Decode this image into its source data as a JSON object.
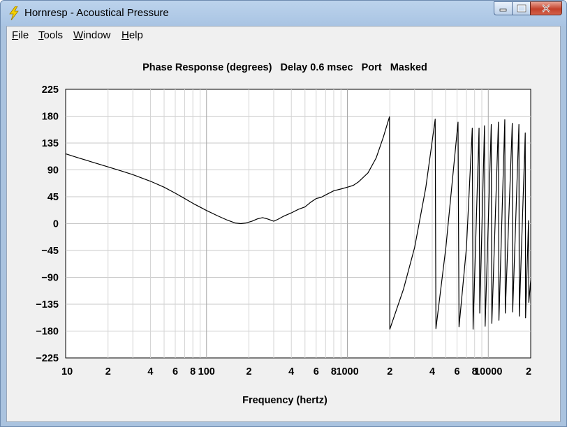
{
  "window": {
    "title": "Hornresp - Acoustical Pressure"
  },
  "menu": [
    {
      "label": "File",
      "mnemonic": "F",
      "rest": "ile"
    },
    {
      "label": "Tools",
      "mnemonic": "T",
      "rest": "ools"
    },
    {
      "label": "Window",
      "mnemonic": "W",
      "rest": "indow"
    },
    {
      "label": "Help",
      "mnemonic": "H",
      "rest": "elp"
    }
  ],
  "chart_data": {
    "type": "line",
    "title": "Phase Response (degrees)   Delay 0.6 msec   Port   Masked",
    "xlabel": "Frequency (hertz)",
    "ylabel": "",
    "x_scale": "log",
    "xlim": [
      10,
      20000
    ],
    "ylim": [
      -225,
      225
    ],
    "y_ticks": [
      225,
      180,
      135,
      90,
      45,
      0,
      -45,
      -90,
      -135,
      -180,
      -225
    ],
    "x_tick_labels": [
      {
        "value": 10,
        "label": "10"
      },
      {
        "value": 20,
        "label": "2"
      },
      {
        "value": 40,
        "label": "4"
      },
      {
        "value": 60,
        "label": "6"
      },
      {
        "value": 80,
        "label": "8"
      },
      {
        "value": 100,
        "label": "100"
      },
      {
        "value": 200,
        "label": "2"
      },
      {
        "value": 400,
        "label": "4"
      },
      {
        "value": 600,
        "label": "6"
      },
      {
        "value": 800,
        "label": "8"
      },
      {
        "value": 1000,
        "label": "1000"
      },
      {
        "value": 2000,
        "label": "2"
      },
      {
        "value": 4000,
        "label": "4"
      },
      {
        "value": 6000,
        "label": "6"
      },
      {
        "value": 8000,
        "label": "8"
      },
      {
        "value": 10000,
        "label": "10000"
      },
      {
        "value": 20000,
        "label": "2"
      }
    ],
    "grid": true,
    "series": [
      {
        "color": "#000000",
        "points": [
          [
            10,
            117
          ],
          [
            12,
            111
          ],
          [
            15,
            104
          ],
          [
            20,
            95
          ],
          [
            25,
            88
          ],
          [
            30,
            82
          ],
          [
            40,
            71
          ],
          [
            50,
            61
          ],
          [
            60,
            51
          ],
          [
            70,
            42
          ],
          [
            80,
            34
          ],
          [
            100,
            22
          ],
          [
            120,
            13
          ],
          [
            140,
            6
          ],
          [
            160,
            1
          ],
          [
            175,
            0
          ],
          [
            190,
            1
          ],
          [
            210,
            4
          ],
          [
            230,
            8
          ],
          [
            250,
            10
          ],
          [
            270,
            8
          ],
          [
            300,
            4
          ],
          [
            320,
            7
          ],
          [
            350,
            12
          ],
          [
            400,
            18
          ],
          [
            450,
            24
          ],
          [
            500,
            28
          ],
          [
            550,
            36
          ],
          [
            600,
            42
          ],
          [
            650,
            44
          ],
          [
            700,
            48
          ],
          [
            800,
            55
          ],
          [
            900,
            58
          ],
          [
            1000,
            61
          ],
          [
            1100,
            64
          ],
          [
            1200,
            70
          ],
          [
            1400,
            85
          ],
          [
            1600,
            110
          ],
          [
            1800,
            145
          ],
          [
            1990,
            179
          ],
          [
            2000,
            -177
          ],
          [
            2500,
            -110
          ],
          [
            3000,
            -40
          ],
          [
            3600,
            60
          ],
          [
            4200,
            175
          ],
          [
            4250,
            -176
          ],
          [
            5000,
            -40
          ],
          [
            6100,
            170
          ],
          [
            6200,
            -173
          ],
          [
            7000,
            -40
          ],
          [
            7700,
            160
          ],
          [
            7800,
            -177
          ],
          [
            8600,
            160
          ],
          [
            8700,
            -150
          ],
          [
            9400,
            164
          ],
          [
            9500,
            -172
          ],
          [
            10500,
            166
          ],
          [
            10600,
            -167
          ],
          [
            11800,
            170
          ],
          [
            11900,
            -162
          ],
          [
            13100,
            174
          ],
          [
            13200,
            -150
          ],
          [
            14800,
            168
          ],
          [
            14900,
            -148
          ],
          [
            16500,
            166
          ],
          [
            16600,
            -155
          ],
          [
            18300,
            152
          ],
          [
            18400,
            -158
          ],
          [
            19300,
            5
          ],
          [
            19400,
            -132
          ],
          [
            20000,
            -95
          ]
        ]
      }
    ]
  }
}
